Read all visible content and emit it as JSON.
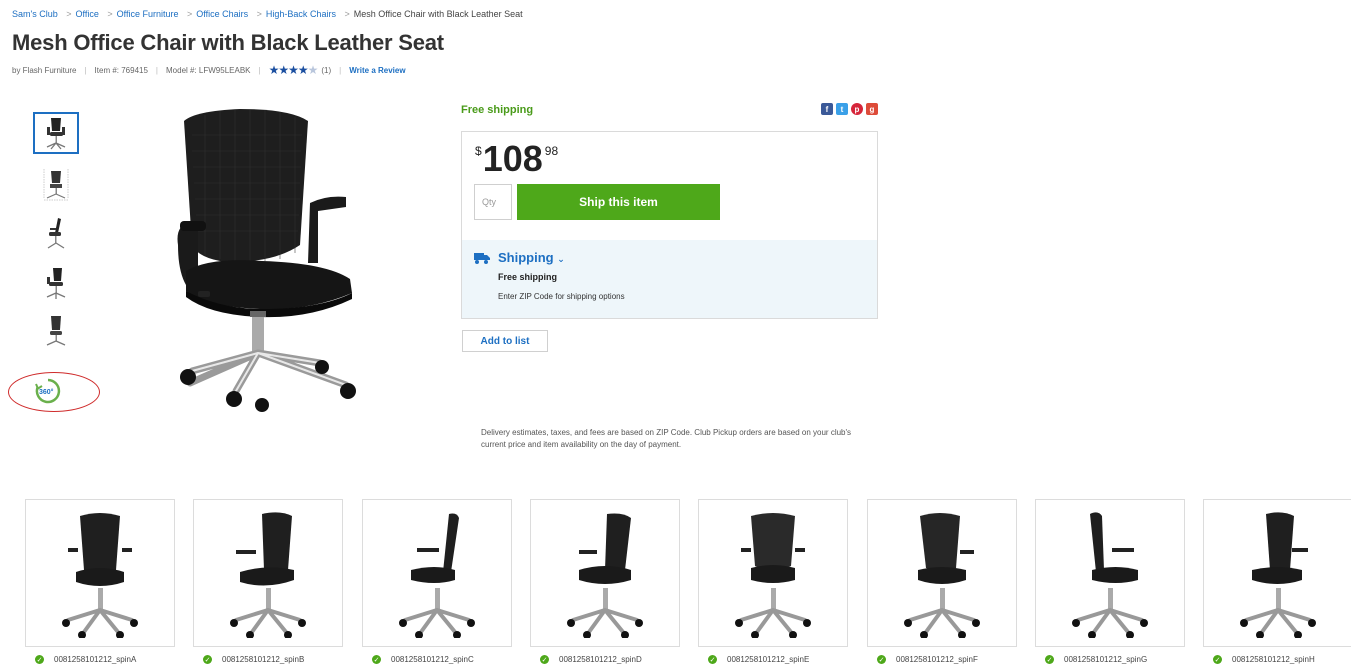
{
  "breadcrumb": {
    "items": [
      "Sam's Club",
      "Office",
      "Office Furniture",
      "Office Chairs",
      "High-Back Chairs"
    ],
    "current": "Mesh Office Chair with Black Leather Seat",
    "separator": ">"
  },
  "product": {
    "title": "Mesh Office Chair with Black Leather Seat",
    "brand": "by Flash Furniture",
    "item_number": "Item #: 769415",
    "model_number": "Model #: LFW95LEABK",
    "rating_stars_filled": 4,
    "rating_stars_total": 5,
    "review_count": "(1)",
    "write_review": "Write a Review"
  },
  "gallery": {
    "thumbnail_count": 5,
    "active_thumbnail": 0,
    "spin_icon": "360-spin-icon",
    "spin_label": "360°"
  },
  "buy_box": {
    "free_shipping": "Free shipping",
    "social_icons": [
      "facebook-icon",
      "twitter-icon",
      "pinterest-icon",
      "google-plus-icon"
    ],
    "price_currency": "$",
    "price_dollars": "108",
    "price_cents": "98",
    "qty_placeholder": "Qty",
    "ship_button": "Ship this item",
    "shipping_label": "Shipping",
    "shipping_free": "Free shipping",
    "shipping_zip": "Enter ZIP Code for shipping options",
    "add_to_list": "Add to list",
    "disclaimer": "Delivery estimates, taxes, and fees are based on ZIP Code. Club Pickup orders are based on your club's current price and item availability on the day of payment."
  },
  "spin_images": [
    {
      "caption": "0081258101212_spinA"
    },
    {
      "caption": "0081258101212_spinB"
    },
    {
      "caption": "0081258101212_spinC"
    },
    {
      "caption": "0081258101212_spinD"
    },
    {
      "caption": "0081258101212_spinE"
    },
    {
      "caption": "0081258101212_spinF"
    },
    {
      "caption": "0081258101212_spinG"
    },
    {
      "caption": "0081258101212_spinH"
    }
  ],
  "colors": {
    "link": "#1d6fc2",
    "ship_button": "#4ea81a",
    "shipping_panel": "#eef6fa",
    "annotation_circle": "#cf2b2b"
  }
}
